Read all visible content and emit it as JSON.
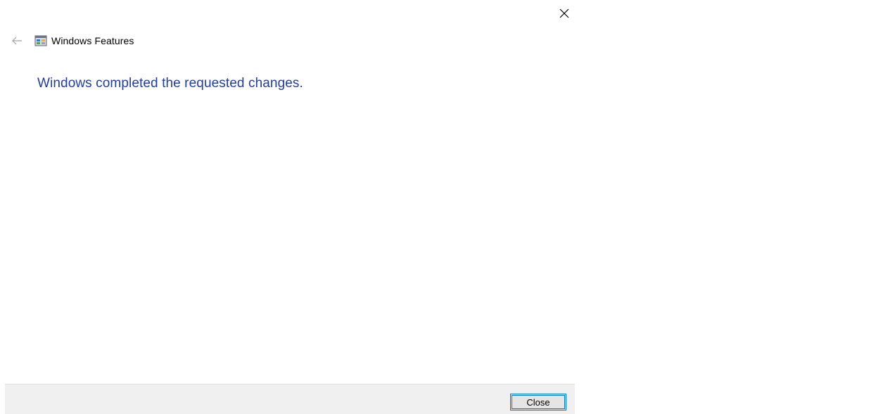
{
  "window": {
    "title": "Windows Features",
    "close_icon": "close-icon",
    "back_icon": "back-arrow-icon",
    "app_icon": "windows-features-icon"
  },
  "main": {
    "message": "Windows completed the requested changes."
  },
  "footer": {
    "close_label": "Close"
  },
  "colors": {
    "message": "#1f3ea0",
    "footer_bg": "#f0f0f0",
    "button_focus_border": "#0078d7"
  }
}
